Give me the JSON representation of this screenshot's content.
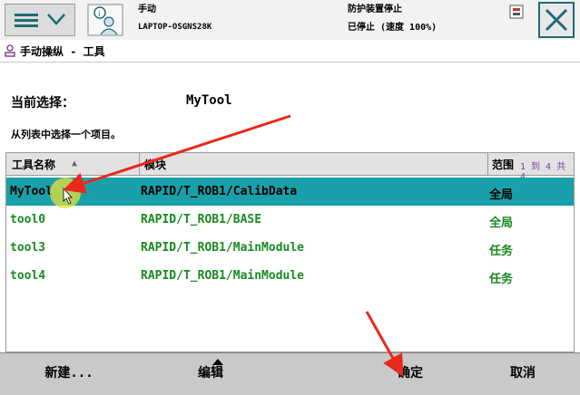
{
  "header": {
    "mode": "手动",
    "controller": "LAPTOP-OSGNS28K",
    "safety_state": "防护装置停止",
    "run_state": "已停止 (速度 100%)"
  },
  "icons": {
    "menu": "hamburger-icon",
    "chevron": "chevron-down-icon",
    "app": "info-user-icon",
    "close": "close-icon",
    "status": "status-icon",
    "breadcrumb": "jog-icon"
  },
  "breadcrumb": {
    "label": "手动操纵 - 工具"
  },
  "selection": {
    "label": "当前选择：",
    "value": "MyTool"
  },
  "instruction": "从列表中选择一个项目。",
  "table": {
    "columns": [
      "工具名称",
      "模块",
      "范围"
    ],
    "page_info": "1 到 4 共 4",
    "rows": [
      {
        "name": "MyTool",
        "module": "RAPID/T_ROB1/CalibData",
        "scope": "全局"
      },
      {
        "name": "tool0",
        "module": "RAPID/T_ROB1/BASE",
        "scope": "全局"
      },
      {
        "name": "tool3",
        "module": "RAPID/T_ROB1/MainModule",
        "scope": "任务"
      },
      {
        "name": "tool4",
        "module": "RAPID/T_ROB1/MainModule",
        "scope": "任务"
      }
    ]
  },
  "footer": {
    "new": "新建...",
    "edit": "编辑",
    "ok": "确定",
    "cancel": "取消"
  },
  "colors": {
    "selected_row": "#1aa0aa",
    "row_text": "#178a22",
    "annotation_arrow": "#e8291c",
    "accent": "#1f6b78"
  }
}
